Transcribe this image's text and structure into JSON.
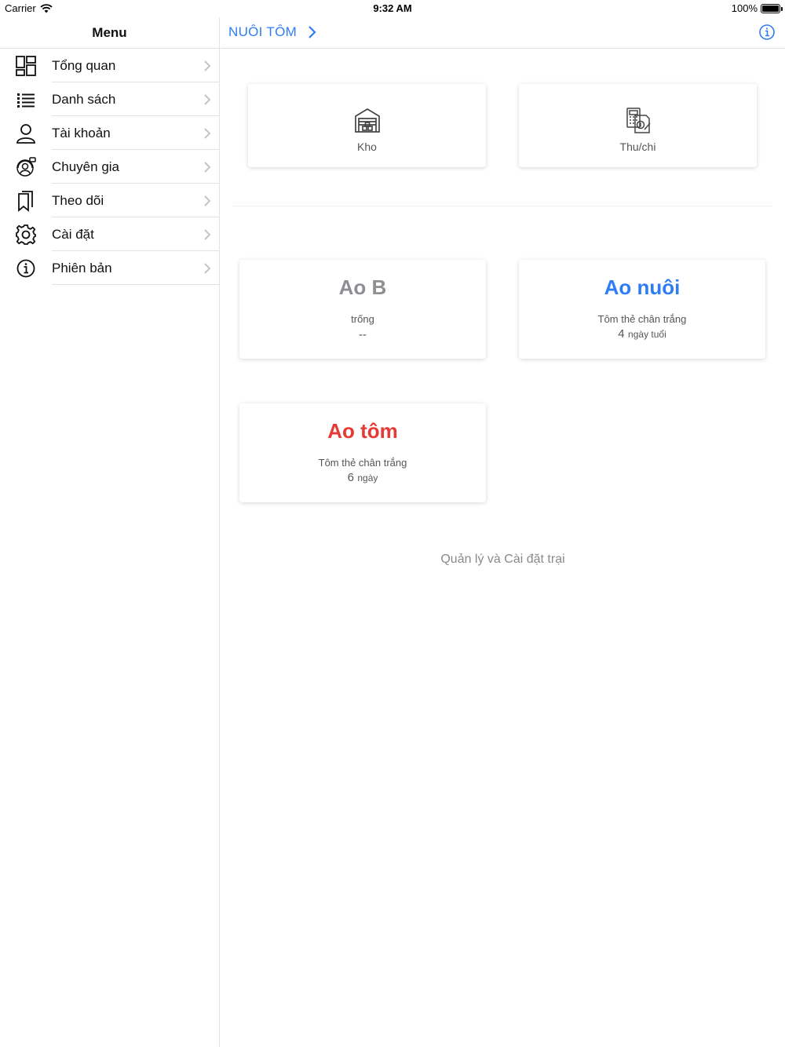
{
  "status_bar": {
    "carrier": "Carrier",
    "time": "9:32 AM",
    "battery": "100%"
  },
  "sidebar": {
    "title": "Menu",
    "items": [
      {
        "label": "Tổng quan",
        "icon": "dashboard-icon"
      },
      {
        "label": "Danh sách",
        "icon": "list-icon"
      },
      {
        "label": "Tài khoản",
        "icon": "user-icon"
      },
      {
        "label": "Chuyên gia",
        "icon": "expert-support-icon"
      },
      {
        "label": "Theo dõi",
        "icon": "bookmarks-icon"
      },
      {
        "label": "Cài đặt",
        "icon": "gear-icon"
      },
      {
        "label": "Phiên bản",
        "icon": "info-icon"
      }
    ]
  },
  "header": {
    "title": "NUÔI TÔM"
  },
  "tiles": [
    {
      "label": "Kho",
      "icon": "warehouse-icon"
    },
    {
      "label": "Thu/chi",
      "icon": "calculator-receipt-icon"
    }
  ],
  "ponds": [
    {
      "name": "Ao B",
      "status": "trống",
      "age_num": "--",
      "age_unit": "",
      "color": "#8e8e93"
    },
    {
      "name": "Ao nuôi",
      "status": "Tôm thẻ chân trắng",
      "age_num": "4",
      "age_unit": "ngày tuổi",
      "color": "#2f7df6"
    },
    {
      "name": "Ao tôm",
      "status": "Tôm thẻ chân trắng",
      "age_num": "6",
      "age_unit": "ngày",
      "color": "#e53935"
    }
  ],
  "footer": {
    "note": "Quản lý và Cài đặt trại"
  },
  "colors": {
    "accent": "#2f7df6",
    "danger": "#e53935",
    "muted": "#8e8e93"
  }
}
